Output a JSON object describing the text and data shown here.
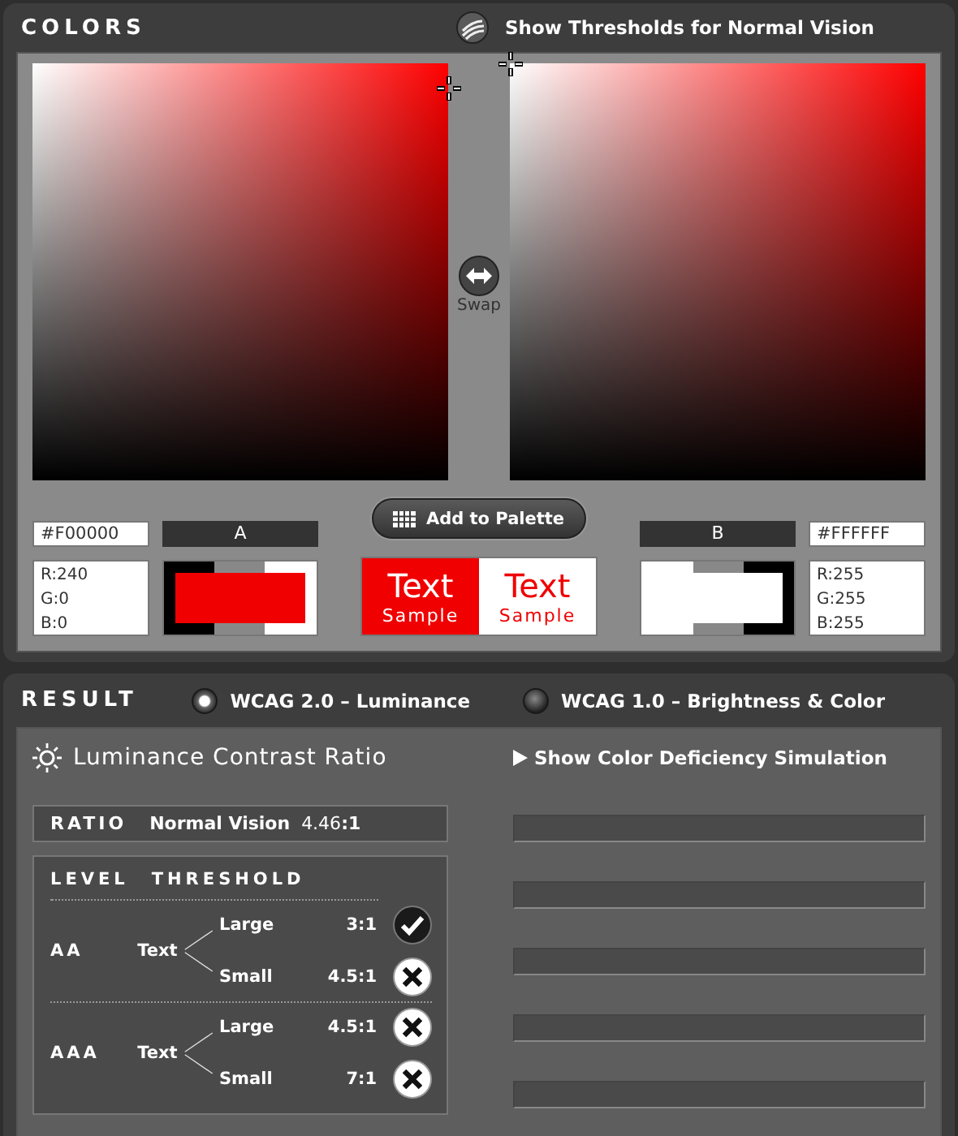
{
  "colors": {
    "title": "COLORS",
    "threshold_toggle": {
      "label": "Show Thresholds for Normal Vision"
    },
    "swatches": [
      {
        "name": "A",
        "hex": "#F00000",
        "rgb": [
          "R:240",
          "G:0",
          "B:0"
        ]
      },
      {
        "name": "B",
        "hex": "#FFFFFF",
        "rgb": [
          "R:255",
          "G:255",
          "B:255"
        ]
      }
    ],
    "swap": {
      "label": "Swap"
    },
    "add_to_palette": {
      "label": "Add to Palette"
    },
    "samples": [
      {
        "text": "Text",
        "caption": "Sample"
      },
      {
        "text": "Text",
        "caption": "Sample"
      }
    ]
  },
  "result": {
    "title": "RESULT",
    "modes": [
      {
        "label": "WCAG 2.0 – Luminance",
        "selected": true
      },
      {
        "label": "WCAG 1.0 – Brightness & Color",
        "selected": false
      }
    ],
    "heading": "Luminance Contrast Ratio",
    "deficiency_toggle": {
      "label": "Show Color Deficiency Simulation",
      "expanded": false
    },
    "ratio": {
      "label": "RATIO",
      "vision": "Normal Vision",
      "value": "4.46**:1**"
    },
    "table": {
      "headers": [
        "LEVEL",
        "THRESHOLD"
      ],
      "levels": [
        {
          "level": "AA",
          "target": "Text",
          "sizes": [
            {
              "size": "Large",
              "ratio": "3:1",
              "passed": true
            },
            {
              "size": "Small",
              "ratio": "4.5:1",
              "passed": false
            }
          ]
        },
        {
          "level": "AAA",
          "target": "Text",
          "sizes": [
            {
              "size": "Large",
              "ratio": "4.5:1",
              "passed": false
            },
            {
              "size": "Small",
              "ratio": "7:1",
              "passed": false
            }
          ]
        }
      ]
    }
  }
}
